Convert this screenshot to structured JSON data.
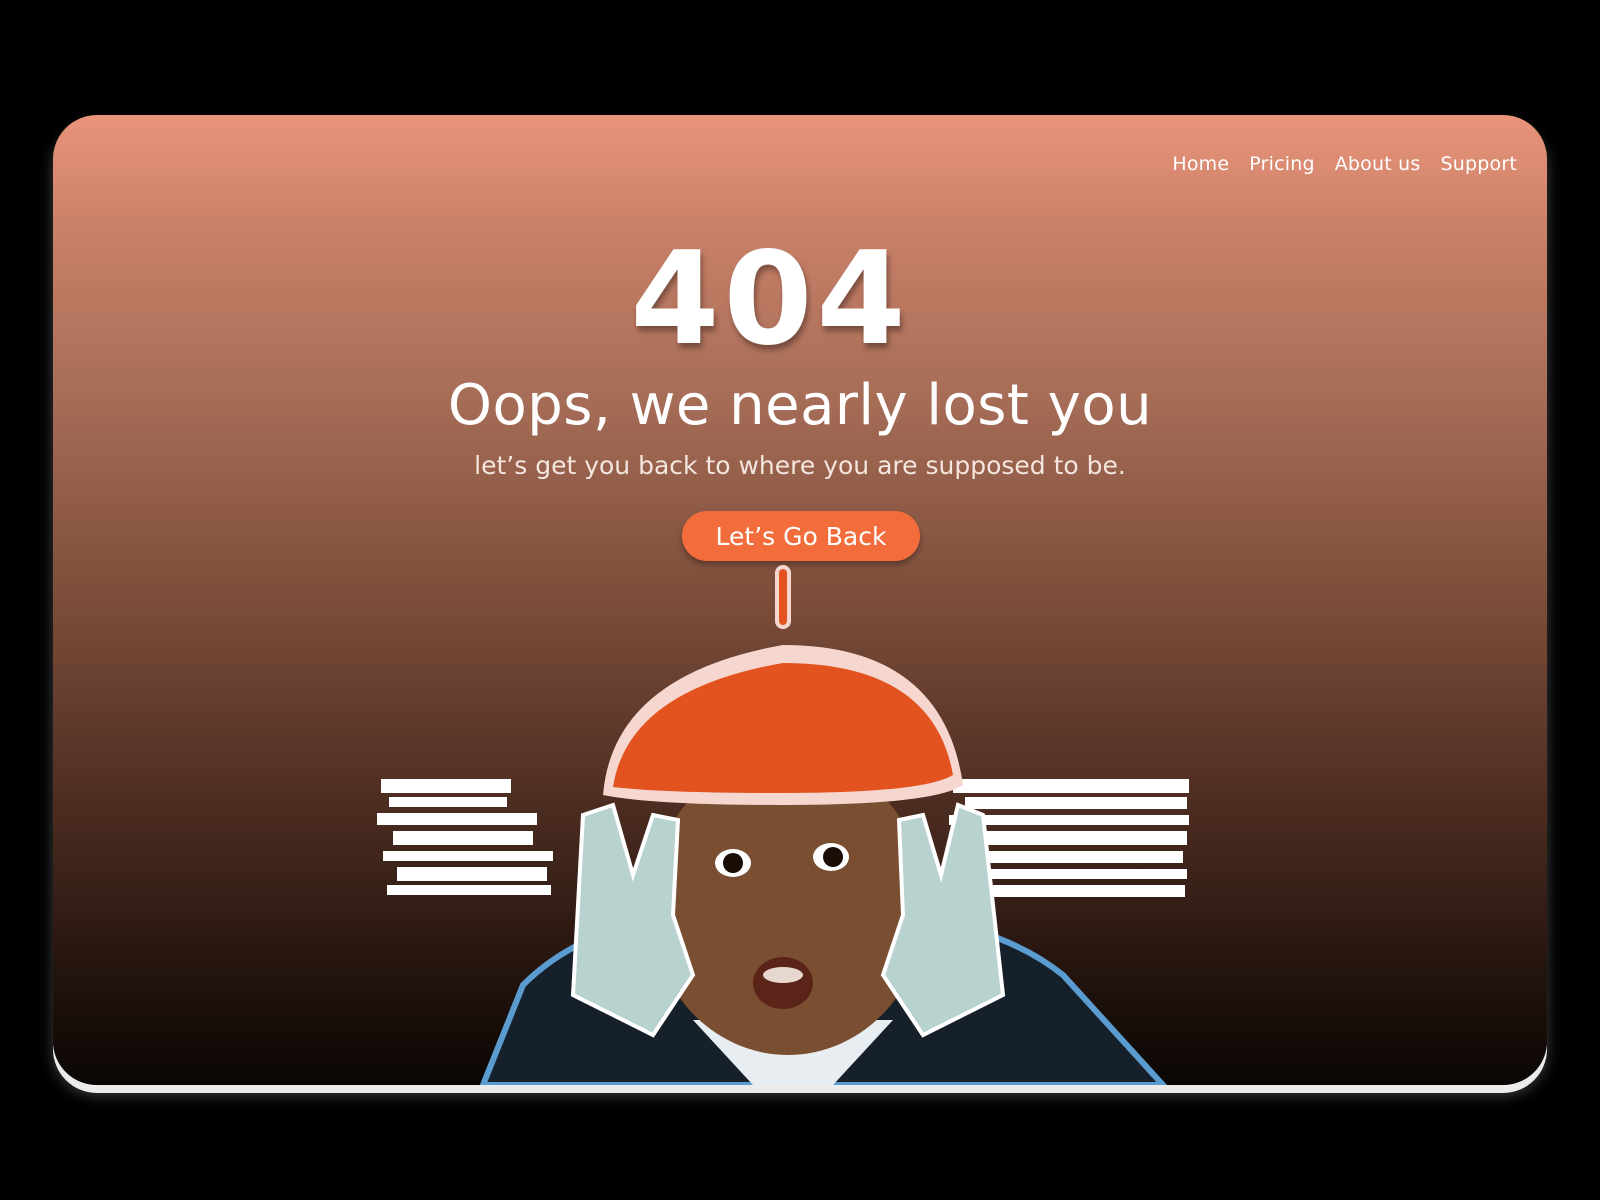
{
  "nav": {
    "items": [
      "Home",
      "Pricing",
      "About us",
      "Support"
    ]
  },
  "error": {
    "code": "404",
    "headline": "Oops, we nearly lost you",
    "subline": "let’s get you back to where you are supposed to be.",
    "button_label": "Let’s Go Back"
  },
  "colors": {
    "accent": "#f36d3c",
    "gradient_top": "#e8947a",
    "gradient_bottom": "#0a0604"
  },
  "icons": [
    "boy-with-beret-illustration",
    "glitch-wow-text"
  ]
}
